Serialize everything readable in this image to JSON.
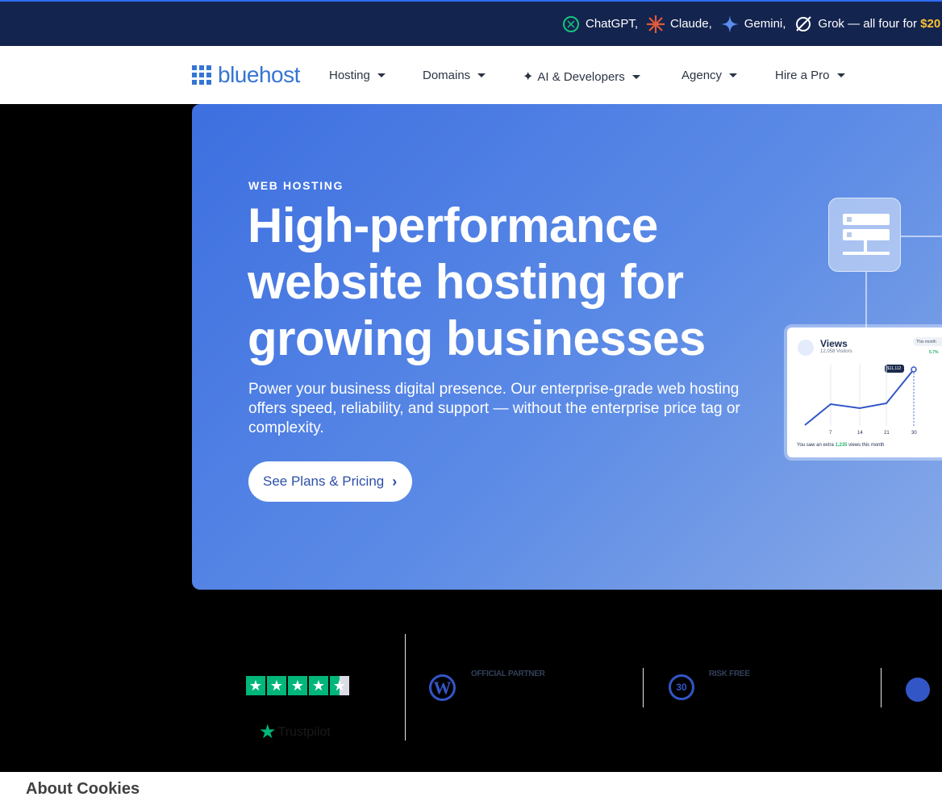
{
  "promo": {
    "items": [
      {
        "label": "ChatGPT,",
        "icon": "chatgpt-icon"
      },
      {
        "label": "Claude,",
        "icon": "claude-icon"
      },
      {
        "label": "Gemini,",
        "icon": "gemini-icon"
      },
      {
        "label": "Grok — all four for",
        "icon": "grok-icon"
      }
    ],
    "price": "$20",
    "colors": {
      "background": "#13244f",
      "price": "#fcc331"
    }
  },
  "nav": {
    "logo": "bluehost",
    "items": [
      {
        "label": "Hosting"
      },
      {
        "label": "Domains"
      },
      {
        "label": "AI & Developers",
        "icon": "sparkle-icon"
      },
      {
        "label": "Agency"
      },
      {
        "label": "Hire a Pro"
      }
    ]
  },
  "hero": {
    "eyebrow": "WEB HOSTING",
    "headline": "High-performance website hosting for growing businesses",
    "subtitle": "Power your business digital presence. Our enterprise-grade web hosting offers speed, reliability, and support — without the enterprise price tag or complexity.",
    "cta": "See Plans & Pricing",
    "colors": {
      "gradient_start": "#3d6fe0",
      "gradient_end": "#87a9e7"
    }
  },
  "views_card": {
    "title": "Views",
    "subtitle": "12,058 Visitors",
    "period": "This month",
    "badge": "5.7%",
    "tooltip": "$11,112",
    "x_ticks": [
      "7",
      "14",
      "21",
      "30"
    ],
    "footer_prefix": "You saw an extra",
    "footer_value": "1,235",
    "footer_suffix": "views this month"
  },
  "trust": {
    "rating_stars": 4.5,
    "trustpilot": "Trustpilot",
    "badge1": "OFFICIAL PARTNER",
    "badge2": "RISK FREE",
    "thirty": "30"
  },
  "cookie": {
    "title": "About Cookies"
  }
}
